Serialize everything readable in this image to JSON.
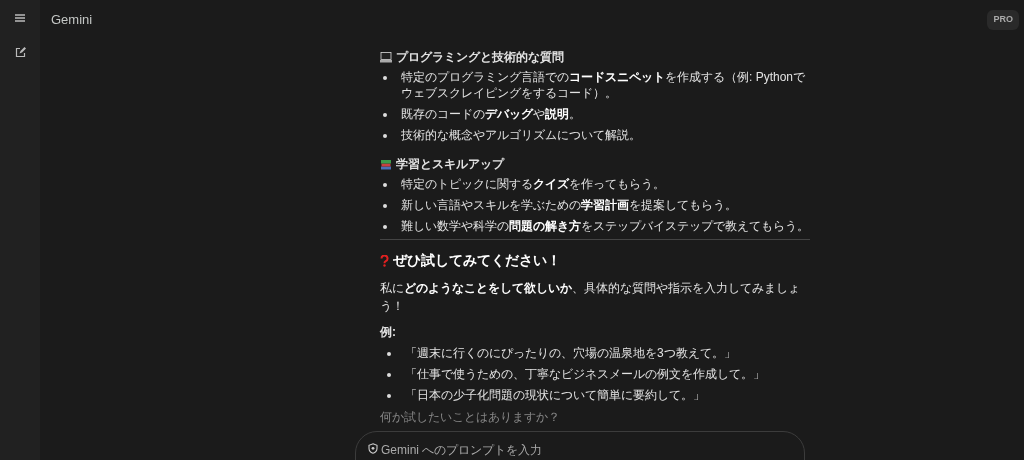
{
  "app": {
    "title": "Gemini",
    "badge": "PRO"
  },
  "sections": [
    {
      "kind": "laptop",
      "heading": "プログラミングと技術的な質問",
      "items": [
        "特定のプログラミング言語での**コードスニペット**を作成する（例: Pythonでウェブスクレイピングをするコード）。",
        "既存のコードの**デバッグ**や**説明**。",
        "技術的な概念やアルゴリズムについて解説。"
      ]
    },
    {
      "kind": "books",
      "heading": "学習とスキルアップ",
      "items": [
        "特定のトピックに関する**クイズ**を作ってもらう。",
        "新しい言語やスキルを学ぶための**学習計画**を提案してもらう。",
        "難しい数学や科学の**問題の解き方**をステップバイステップで教えてもらう。"
      ]
    }
  ],
  "try_section": {
    "heading": "ぜひ試してみてください！",
    "intro": "私に**どのようなことをして欲しいか**、具体的な質問や指示を入力してみましょう！",
    "examples_label": "例:",
    "examples": [
      "「週末に行くのにぴったりの、穴場の温泉地を3つ教えて。」",
      "「仕事で使うための、丁寧なビジネスメールの例文を作成して。」",
      "「日本の少子化問題の現状について簡単に要約して。」"
    ],
    "closing": "何か試したいことはありますか？"
  },
  "prompt": {
    "placeholder": "Gemini へのプロンプトを入力"
  }
}
